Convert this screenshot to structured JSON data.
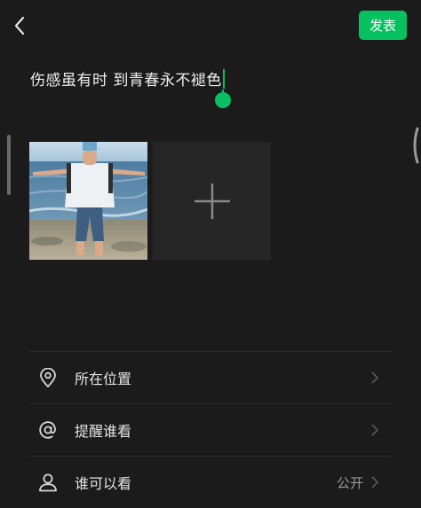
{
  "header": {
    "publish_label": "发表"
  },
  "composer": {
    "text": "伤感虽有时 到青春永不褪色"
  },
  "icons": {
    "back": "chevron-left-icon",
    "add": "plus-icon",
    "location": "location-pin-icon",
    "mention": "at-sign-icon",
    "visibility": "person-icon",
    "chevron": "chevron-right-icon"
  },
  "options": [
    {
      "label": "所在位置",
      "value": ""
    },
    {
      "label": "提醒谁看",
      "value": ""
    },
    {
      "label": "谁可以看",
      "value": "公开"
    }
  ],
  "colors": {
    "accent": "#07c160",
    "background": "#1b1b1b",
    "tile": "#262626"
  }
}
